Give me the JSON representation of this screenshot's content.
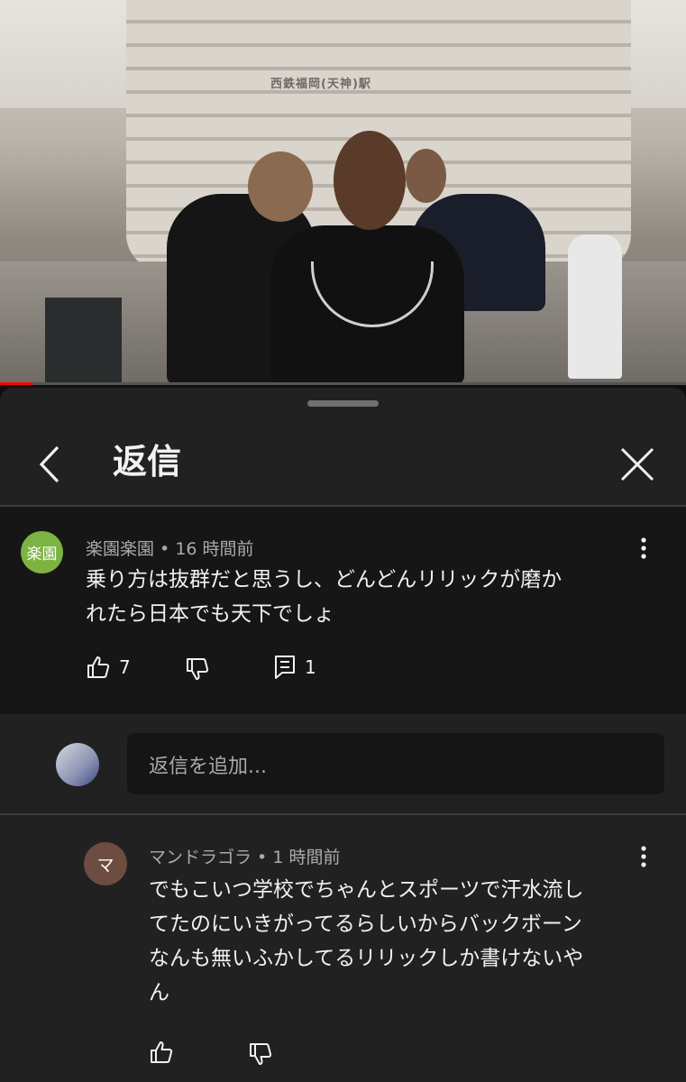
{
  "video": {
    "sign_text": "西鉄福岡(天神)駅",
    "progress_fraction": 0.047
  },
  "panel": {
    "title": "返信"
  },
  "comment": {
    "avatar_text": "楽園",
    "avatar_color": "#7cb342",
    "author": "楽園楽園",
    "time": "16 時間前",
    "text_lines": [
      "乗り方は抜群だと思うし、どんどんリリックが磨か",
      "れたら日本でも天下でしょ"
    ],
    "like_count": "7",
    "reply_count": "1"
  },
  "reply_input": {
    "placeholder": "返信を追加..."
  },
  "reply": {
    "avatar_text": "マ",
    "avatar_color": "#6d4c41",
    "author": "マンドラゴラ",
    "time": "1 時間前",
    "text_lines": [
      "でもこいつ学校でちゃんとスポーツで汗水流し",
      "てたのにいきがってるらしいからバックボーン",
      "なんも無いふかしてるリリックしか書けないや",
      "ん"
    ]
  },
  "separator": " • ",
  "icons": [
    "chevron-left-icon",
    "close-icon",
    "more-vert-icon",
    "thumbs-up-icon",
    "thumbs-down-icon",
    "comment-icon"
  ]
}
